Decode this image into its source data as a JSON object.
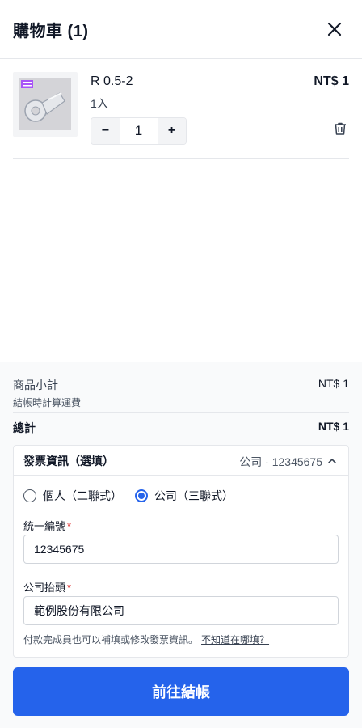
{
  "cart": {
    "title": "購物車 (1)"
  },
  "item": {
    "name": "R 0.5-2",
    "variant": "1入",
    "price": "NT$ 1",
    "quantity": "1",
    "minus_label": "−",
    "plus_label": "+",
    "image_label": "R 0.5-2 product photo",
    "image_badge": "端子"
  },
  "summary": {
    "subtotal_label": "商品小計",
    "subtotal_value": "NT$ 1",
    "shipping_note": "結帳時計算運費",
    "total_label": "總計",
    "total_value": "NT$ 1"
  },
  "invoice": {
    "title": "發票資訊（選填）",
    "summary": "公司 · 12345675",
    "options": [
      "個人（二聯式）",
      "公司（三聯式）"
    ],
    "selected": "公司（三聯式）",
    "tax_id_label": "統一編號",
    "tax_id_value": "12345675",
    "company_label": "公司抬頭",
    "company_value": "範例股份有限公司",
    "required_mark": "*",
    "hint": "付款完成員也可以補填或修改發票資訊。",
    "hint_link": "不知道在哪填？"
  },
  "checkout": {
    "label": "前往結帳"
  },
  "colors": {
    "accent": "#2563eb",
    "required": "#dc2626"
  }
}
